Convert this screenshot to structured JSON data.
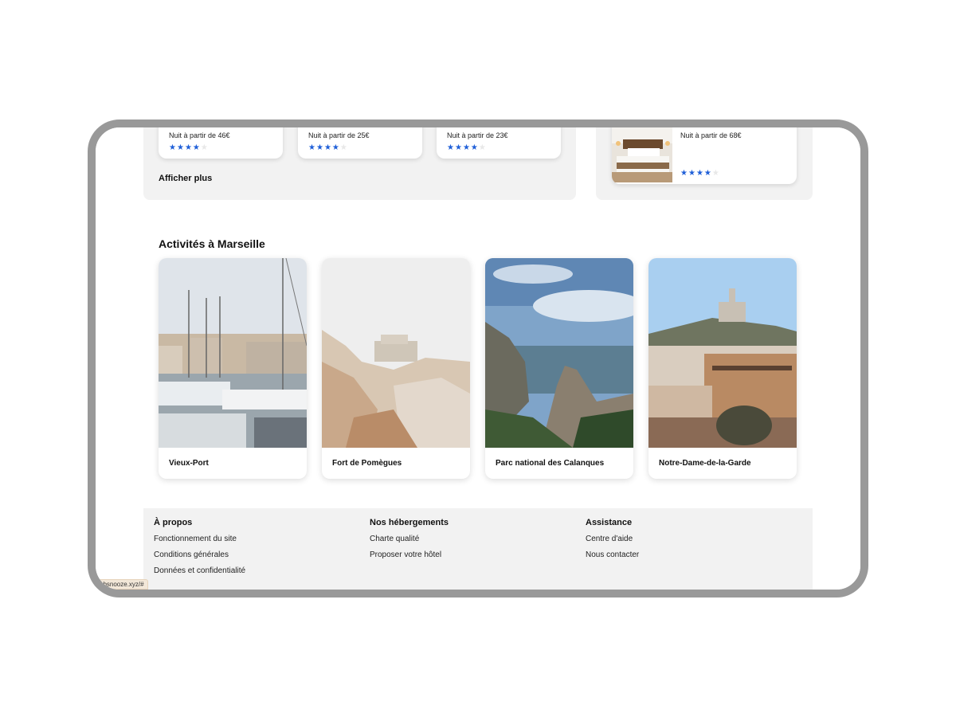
{
  "hotels": {
    "cards": [
      {
        "price": "Nuit à partir de 46€",
        "rating": 4
      },
      {
        "price": "Nuit à partir de 25€",
        "rating": 4
      },
      {
        "price": "Nuit à partir de 23€",
        "rating": 4
      }
    ],
    "show_more": "Afficher plus"
  },
  "featured": {
    "price": "Nuit à partir de 68€",
    "rating": 4
  },
  "activities": {
    "title": "Activités à Marseille",
    "items": [
      {
        "label": "Vieux-Port"
      },
      {
        "label": "Fort de Pomègues"
      },
      {
        "label": "Parc national des Calanques"
      },
      {
        "label": "Notre-Dame-de-la-Garde"
      }
    ]
  },
  "footer": {
    "about": {
      "title": "À propos",
      "links": [
        "Fonctionnement du site",
        "Conditions générales",
        "Données et confidentialité"
      ]
    },
    "accommodations": {
      "title": "Nos hébergements",
      "links": [
        "Charte qualité",
        "Proposer votre hôtel"
      ]
    },
    "support": {
      "title": "Assistance",
      "links": [
        "Centre d'aide",
        "Nous contacter"
      ]
    }
  },
  "status_bar": {
    "url": "ebsnooze.xyz/#"
  },
  "colors": {
    "star_active": "#1f5fd8",
    "star_inactive": "#e8e8e8",
    "panel_bg": "#f2f2f2",
    "frame": "#999999"
  }
}
